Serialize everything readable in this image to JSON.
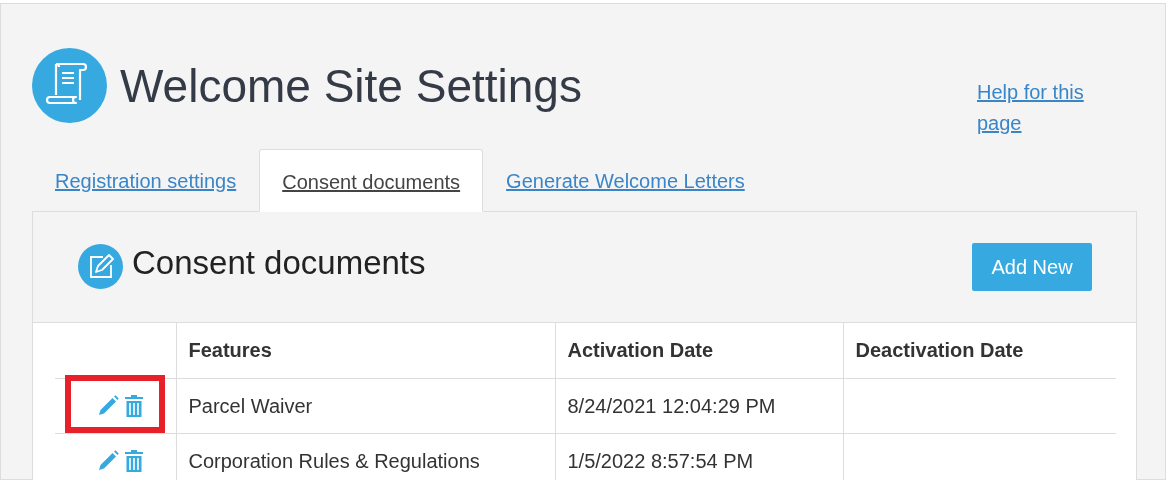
{
  "page": {
    "title": "Welcome Site Settings",
    "help_link": "Help for this page"
  },
  "tabs": [
    {
      "label": "Registration settings",
      "selected": false
    },
    {
      "label": "Consent documents",
      "selected": true
    },
    {
      "label": "Generate Welcome Letters",
      "selected": false
    }
  ],
  "section": {
    "title": "Consent documents",
    "add_button": "Add New"
  },
  "table": {
    "columns": [
      "Features",
      "Activation Date",
      "Deactivation Date"
    ],
    "rows": [
      {
        "feature": "Parcel Waiver",
        "activation": "8/24/2021 12:04:29 PM",
        "highlighted": true
      },
      {
        "feature": "Corporation Rules & Regulations",
        "activation": "1/5/2022 8:57:54 PM",
        "highlighted": false
      }
    ]
  }
}
